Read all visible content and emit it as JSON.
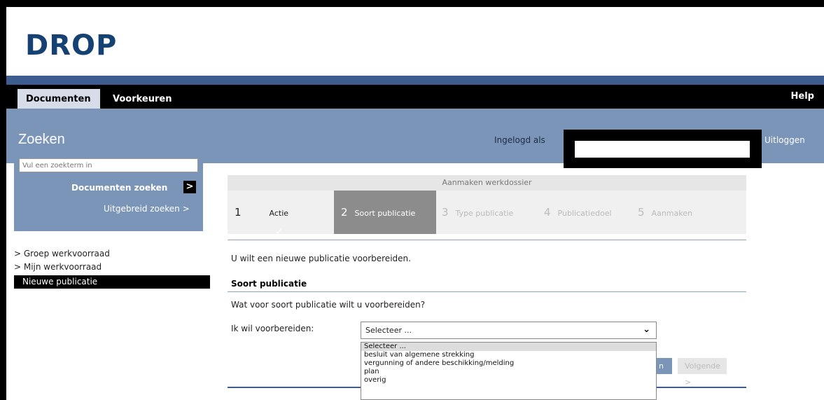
{
  "app": {
    "logo": "DROP"
  },
  "topnav": {
    "tabs": [
      "Documenten",
      "Voorkeuren"
    ],
    "help": "Help"
  },
  "header": {
    "title": "Zoeken",
    "logged_in_label": "Ingelogd als",
    "logout": "Uitloggen"
  },
  "search": {
    "placeholder": "Vul een zoekterm in",
    "docs_search": "Documenten zoeken",
    "docs_search_arrow": ">",
    "advanced": "Uitgebreid zoeken >"
  },
  "sidebar": {
    "items": [
      {
        "label": "> Groep werkvoorraad",
        "active": false
      },
      {
        "label": "> Mijn werkvoorraad",
        "active": false
      },
      {
        "label": "Nieuwe publicatie",
        "active": true
      }
    ]
  },
  "wizard": {
    "title": "Aanmaken werkdossier",
    "steps": [
      {
        "num": "1",
        "label": "Actie",
        "check": "✓"
      },
      {
        "num": "2",
        "label": "Soort publicatie"
      },
      {
        "num": "3",
        "label": "Type publicatie"
      },
      {
        "num": "4",
        "label": "Publicatiedoel"
      },
      {
        "num": "5",
        "label": "Aanmaken"
      }
    ]
  },
  "main": {
    "intro": "U wilt een nieuwe publicatie voorbereiden.",
    "section_title": "Soort publicatie",
    "question": "Wat voor soort publicatie wilt u voorbereiden?",
    "field_label": "Ik wil voorbereiden:",
    "select_value": "Selecteer ...",
    "options": [
      "Selecteer ...",
      "besluit van algemene strekking",
      "vergunning of andere beschikking/melding",
      "plan",
      "overig"
    ],
    "btn_partial": "n",
    "btn_next": "Volgende >"
  },
  "colors": {
    "brand_blue": "#154273",
    "band_blue": "#7b95b8",
    "stripe_blue": "#3d5c8f"
  }
}
